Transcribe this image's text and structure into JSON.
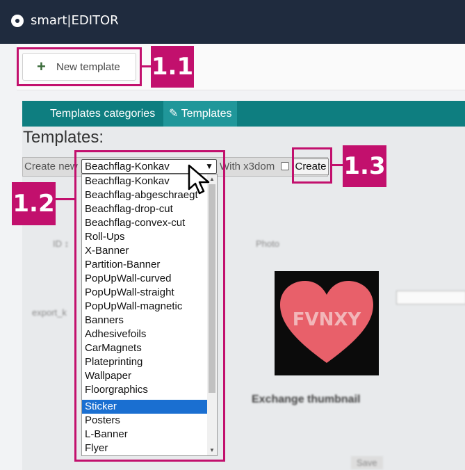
{
  "app": {
    "title": "smart|EDITOR"
  },
  "toolbar": {
    "new_template_label": "New template"
  },
  "callouts": {
    "c11": "1.1",
    "c12": "1.2",
    "c13": "1.3"
  },
  "tabs": [
    {
      "label": "Templates categories"
    },
    {
      "label": "Templates"
    }
  ],
  "page": {
    "heading": "Templates:"
  },
  "create_row": {
    "create_new_label": "Create new",
    "selected": "Beachflag-Konkav",
    "with_x3dom_label": "With x3dom",
    "create_button": "Create"
  },
  "dropdown": {
    "options": [
      "Beachflag-Konkav",
      "Beachflag-abgeschraegt",
      "Beachflag-drop-cut",
      "Beachflag-convex-cut",
      "Roll-Ups",
      "X-Banner",
      "Partition-Banner",
      "PopUpWall-curved",
      "PopUpWall-straight",
      "PopUpWall-magnetic",
      "Banners",
      "Adhesivefoils",
      "CarMagnets",
      "Plateprinting",
      "Wallpaper",
      "Floorgraphics",
      "Sticker",
      "Posters",
      "L-Banner",
      "Flyer"
    ],
    "highlighted_index": 16
  },
  "background": {
    "col_photo": "Photo",
    "exchange_label": "Exchange thumbnail",
    "heart_text": "FVNXY",
    "save_label": "Save"
  },
  "colors": {
    "topbar": "#1f2b3e",
    "tabbar": "#0e7e80",
    "accent": "#c2106d",
    "highlight": "#1a6fd1"
  }
}
